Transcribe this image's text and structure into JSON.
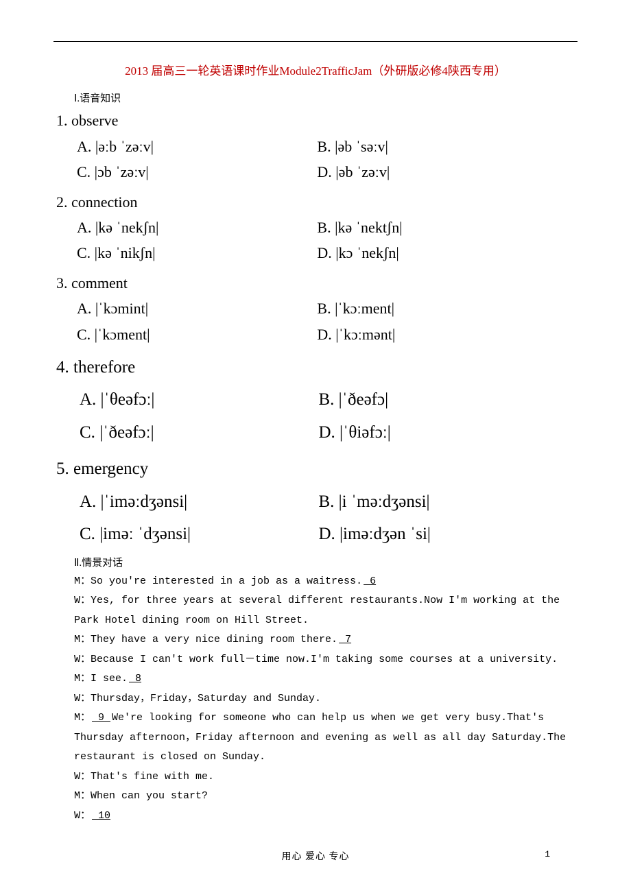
{
  "title": "2013 届高三一轮英语课时作业Module2TrafficJam（外研版必修4陕西专用）",
  "section1": "Ⅰ.语音知识",
  "q1": {
    "head": "1. observe",
    "a": "A. |əːb ˈzəːv|",
    "b": "B. |əb ˈsəːv|",
    "c": "C. |ɔb ˈzəːv|",
    "d": "D. |əb ˈzəːv|"
  },
  "q2": {
    "head": "2. connection",
    "a": "A. |kə ˈnekʃn|",
    "b": "B. |kə ˈnektʃn|",
    "c": "C. |kə ˈnikʃn|",
    "d": "D. |kɔ ˈnekʃn|"
  },
  "q3": {
    "head": "3. comment",
    "a": "A. |ˈkɔmint|",
    "b": "B. |ˈkɔːment|",
    "c": "C. |ˈkɔment|",
    "d": "D. |ˈkɔːmənt|"
  },
  "q4": {
    "head": "4. therefore",
    "a": "A. |ˈθeəfɔː|",
    "b": "B. |ˈðeəfɔ|",
    "c": "C. |ˈðeəfɔː|",
    "d": "D. |ˈθiəfɔː|"
  },
  "q5": {
    "head": "5. emergency",
    "a": "A. |ˈiməːdʒənsi|",
    "b": "B. |i ˈməːdʒənsi|",
    "c": "C. |iməː ˈdʒənsi|",
    "d": "D. |iməːdʒən ˈsi|"
  },
  "section2": "Ⅱ.情景对话",
  "d1a": "M：So you're interested in a job as a waitress.",
  "b6": "  6  ",
  "d2": "W：Yes, for three years at several different restaurants.Now I'm working at the Park Hotel dining room on Hill Street.",
  "d3a": "M：They have a very nice dining room there.",
  "b7": "  7  ",
  "d4": "W：Because I can't work full－time now.I'm taking some courses at a university.",
  "d5a": "M：I see.",
  "b8": "  8  ",
  "d6": "W：Thursday，Friday，Saturday and Sunday.",
  "d7a": "M：",
  "b9": "  9  ",
  "d7b": "We're looking for someone who can help us when we get very busy.That's Thursday afternoon，Friday afternoon and evening as well as all day Saturday.The restaurant is closed on Sunday.",
  "d8": "W：That's fine with me.",
  "d9": "M：When can you start?",
  "d10a": "W：",
  "b10": "  10  ",
  "footer": "用心 爱心 专心",
  "pagenum": "1"
}
